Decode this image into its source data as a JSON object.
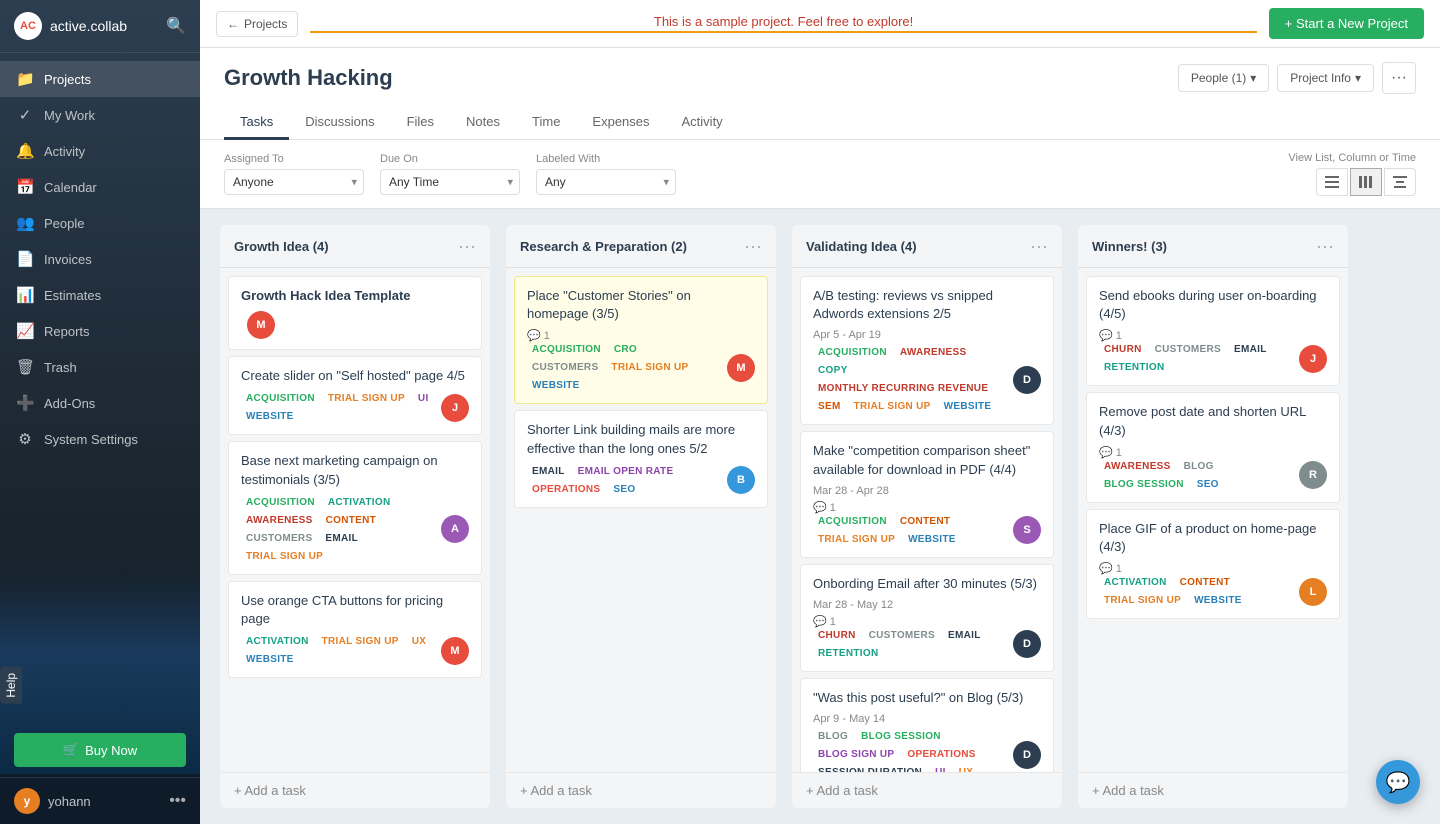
{
  "app": {
    "logo": "AC",
    "name": "active.collab",
    "search_icon": "🔍"
  },
  "sidebar": {
    "nav_items": [
      {
        "id": "projects",
        "label": "Projects",
        "icon": "📁"
      },
      {
        "id": "my-work",
        "label": "My Work",
        "icon": "✓"
      },
      {
        "id": "activity",
        "label": "Activity",
        "icon": "🔔"
      },
      {
        "id": "calendar",
        "label": "Calendar",
        "icon": "📅"
      },
      {
        "id": "people",
        "label": "People",
        "icon": "👥"
      },
      {
        "id": "invoices",
        "label": "Invoices",
        "icon": "📄"
      },
      {
        "id": "estimates",
        "label": "Estimates",
        "icon": "📊"
      },
      {
        "id": "reports",
        "label": "Reports",
        "icon": "📈"
      },
      {
        "id": "trash",
        "label": "Trash",
        "icon": "🗑"
      },
      {
        "id": "addons",
        "label": "Add-Ons",
        "icon": "➕"
      },
      {
        "id": "system-settings",
        "label": "System Settings",
        "icon": "⚙"
      }
    ],
    "buy_now": "Buy Now",
    "user": {
      "initial": "y",
      "name": "yohann"
    }
  },
  "topbar": {
    "back_label": "← Projects",
    "banner": "This is a sample project. Feel free to explore!",
    "start_btn": "+ Start a New Project"
  },
  "project": {
    "title": "Growth Hacking",
    "people_btn": "People (1)",
    "project_info_btn": "Project Info",
    "tabs": [
      "Tasks",
      "Discussions",
      "Files",
      "Notes",
      "Time",
      "Expenses",
      "Activity"
    ],
    "active_tab": "Tasks"
  },
  "filters": {
    "assigned_to_label": "Assigned To",
    "assigned_to_value": "Anyone",
    "due_on_label": "Due On",
    "due_on_value": "Any Time",
    "labeled_with_label": "Labeled With",
    "labeled_with_value": "Any",
    "view_label": "View List, Column or Time"
  },
  "columns": [
    {
      "id": "growth-idea",
      "title": "Growth Idea",
      "count": 4,
      "cards": [
        {
          "title": "**Growth Hack Idea Template**",
          "bold": true,
          "tags": [],
          "avatar_color": "#e74c3c",
          "avatar_initial": "M"
        },
        {
          "title": "Create slider on \"Self hosted\" page 4/5",
          "tags": [
            "ACQUISITION",
            "TRIAL SIGN UP",
            "UI",
            "WEBSITE"
          ],
          "tag_classes": [
            "tag-acquisition",
            "tag-trial-sign-up",
            "tag-ui",
            "tag-website"
          ],
          "avatar_color": "#e74c3c",
          "avatar_initial": "J"
        },
        {
          "title": "Base next marketing campaign on testimonials (3/5)",
          "tags": [
            "ACQUISITION",
            "ACTIVATION",
            "AWARENESS",
            "CONTENT",
            "CUSTOMERS",
            "EMAIL",
            "TRIAL SIGN UP"
          ],
          "tag_classes": [
            "tag-acquisition",
            "tag-activation",
            "tag-awareness",
            "tag-content",
            "tag-customers",
            "tag-email",
            "tag-trial-sign-up"
          ],
          "avatar_color": "#9b59b6",
          "avatar_initial": "A"
        },
        {
          "title": "Use orange CTA buttons for pricing page",
          "tags": [
            "ACTIVATION",
            "TRIAL SIGN UP",
            "UX",
            "WEBSITE"
          ],
          "tag_classes": [
            "tag-activation",
            "tag-trial-sign-up",
            "tag-ux",
            "tag-website"
          ],
          "avatar_color": "#e74c3c",
          "avatar_initial": "M"
        }
      ],
      "add_task": "+ Add a task"
    },
    {
      "id": "research-preparation",
      "title": "Research & Preparation",
      "count": 2,
      "cards": [
        {
          "title": "Place \"Customer Stories\" on homepage (3/5)",
          "highlighted": true,
          "comment_count": 1,
          "tags": [
            "ACQUISITION",
            "CRO",
            "CUSTOMERS",
            "TRIAL SIGN UP",
            "WEBSITE"
          ],
          "tag_classes": [
            "tag-acquisition",
            "tag-cro",
            "tag-customers",
            "tag-trial-sign-up",
            "tag-website"
          ],
          "avatar_color": "#e74c3c",
          "avatar_initial": "M"
        },
        {
          "title": "Shorter Link building mails are more effective than the long ones 5/2",
          "tags": [
            "EMAIL",
            "EMAIL OPEN RATE",
            "OPERATIONS",
            "SEO"
          ],
          "tag_classes": [
            "tag-email",
            "tag-email-open-rate",
            "tag-operations",
            "tag-seo"
          ],
          "avatar_color": "#3498db",
          "avatar_initial": "B"
        }
      ],
      "add_task": "+ Add a task"
    },
    {
      "id": "validating-idea",
      "title": "Validating Idea",
      "count": 4,
      "cards": [
        {
          "title": "A/B testing: reviews vs snipped Adwords extensions 2/5",
          "date": "Apr 5 - Apr 19",
          "tags": [
            "ACQUISITION",
            "AWARENESS",
            "COPY",
            "MONTHLY RECURRING REVENUE",
            "SEM",
            "TRIAL SIGN UP",
            "WEBSITE"
          ],
          "tag_classes": [
            "tag-acquisition",
            "tag-awareness",
            "tag-copy",
            "tag-monthly-recurring-revenue",
            "tag-sem",
            "tag-trial-sign-up",
            "tag-website"
          ],
          "avatar_color": "#2c3e50",
          "avatar_initial": "D"
        },
        {
          "title": "Make \"competition comparison sheet\" available for download in PDF (4/4)",
          "date": "Mar 28 - Apr 28",
          "comment_count": 1,
          "tags": [
            "ACQUISITION",
            "CONTENT",
            "TRIAL SIGN UP",
            "WEBSITE"
          ],
          "tag_classes": [
            "tag-acquisition",
            "tag-content",
            "tag-trial-sign-up",
            "tag-website"
          ],
          "avatar_color": "#9b59b6",
          "avatar_initial": "S"
        },
        {
          "title": "Onbording Email after 30 minutes (5/3)",
          "date": "Mar 28 - May 12",
          "comment_count": 1,
          "tags": [
            "CHURN",
            "CUSTOMERS",
            "EMAIL",
            "RETENTION"
          ],
          "tag_classes": [
            "tag-churn",
            "tag-customers",
            "tag-email",
            "tag-retention"
          ],
          "avatar_color": "#2c3e50",
          "avatar_initial": "D"
        },
        {
          "title": "\"Was this post useful?\" on Blog (5/3)",
          "date": "Apr 9 - May 14",
          "tags": [
            "BLOG",
            "BLOG SESSION",
            "BLOG SIGN UP",
            "OPERATIONS",
            "SESSION DURATION",
            "UI",
            "UX"
          ],
          "tag_classes": [
            "tag-blog",
            "tag-blog-session",
            "tag-blog-sign-up",
            "tag-operations",
            "tag-session-duration",
            "tag-ui",
            "tag-ux"
          ],
          "avatar_color": "#2c3e50",
          "avatar_initial": "D"
        }
      ],
      "add_task": "+ Add a task"
    },
    {
      "id": "winners",
      "title": "Winners!",
      "count": 3,
      "cards": [
        {
          "title": "Send ebooks during user on-boarding (4/5)",
          "comment_count": 1,
          "tags": [
            "CHURN",
            "CUSTOMERS",
            "EMAIL",
            "RETENTION"
          ],
          "tag_classes": [
            "tag-churn",
            "tag-customers",
            "tag-email",
            "tag-retention"
          ],
          "avatar_color": "#e74c3c",
          "avatar_initial": "J"
        },
        {
          "title": "Remove post date and shorten URL (4/3)",
          "comment_count": 1,
          "tags": [
            "AWARENESS",
            "BLOG",
            "BLOG SESSION",
            "SEO"
          ],
          "tag_classes": [
            "tag-awareness",
            "tag-blog",
            "tag-blog-session",
            "tag-seo"
          ],
          "avatar_color": "#7f8c8d",
          "avatar_initial": "R"
        },
        {
          "title": "Place GIF of a product on home-page (4/3)",
          "comment_count": 1,
          "tags": [
            "ACTIVATION",
            "CONTENT",
            "TRIAL SIGN UP",
            "WEBSITE"
          ],
          "tag_classes": [
            "tag-activation",
            "tag-content",
            "tag-trial-sign-up",
            "tag-website"
          ],
          "avatar_color": "#e67e22",
          "avatar_initial": "L"
        }
      ],
      "add_task": "+ Add a task"
    }
  ],
  "help": "Help",
  "chat_icon": "💬"
}
